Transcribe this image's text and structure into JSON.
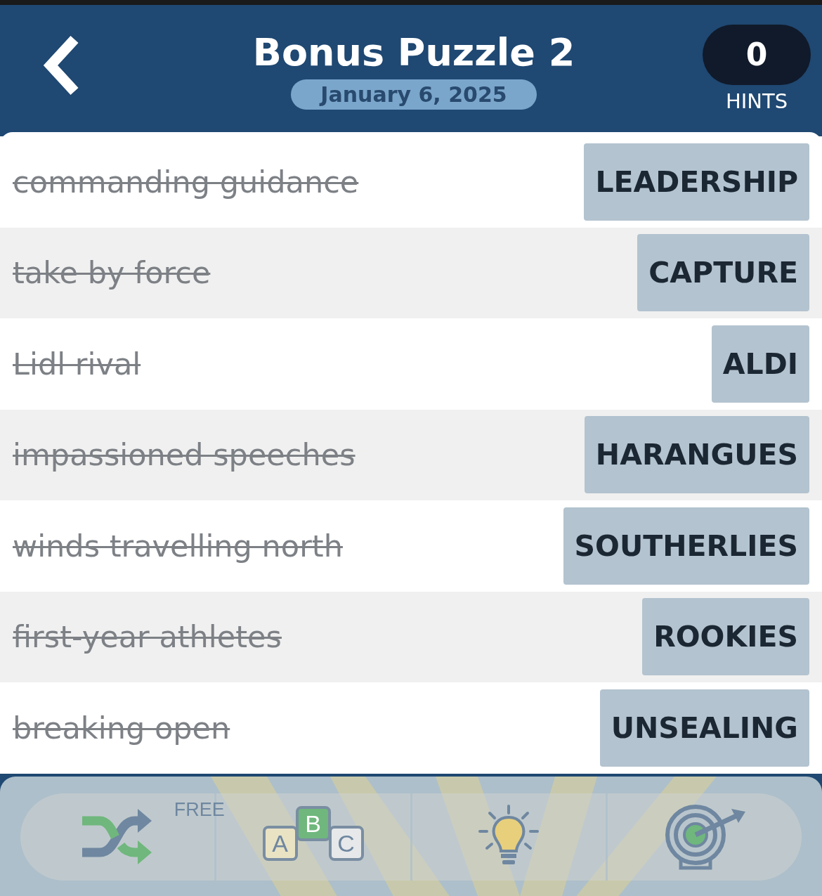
{
  "header": {
    "title": "Bonus Puzzle 2",
    "date": "January 6, 2025",
    "hints": {
      "count": "0",
      "label": "HINTS"
    }
  },
  "clues": [
    {
      "clue": "commanding guidance",
      "answer": "LEADERSHIP",
      "solved": true
    },
    {
      "clue": "take by force",
      "answer": "CAPTURE",
      "solved": true
    },
    {
      "clue": "Lidl rival",
      "answer": "ALDI",
      "solved": true
    },
    {
      "clue": "impassioned speeches",
      "answer": "HARANGUES",
      "solved": true
    },
    {
      "clue": "winds travelling north",
      "answer": "SOUTHERLIES",
      "solved": true
    },
    {
      "clue": "first-year athletes",
      "answer": "ROOKIES",
      "solved": true
    },
    {
      "clue": "breaking open",
      "answer": "UNSEALING",
      "solved": true
    }
  ],
  "toolbar": [
    {
      "kind": "shuffle",
      "badge": "FREE"
    },
    {
      "kind": "letters",
      "letters": [
        "A",
        "B",
        "C"
      ]
    },
    {
      "kind": "hint"
    },
    {
      "kind": "target"
    }
  ]
}
